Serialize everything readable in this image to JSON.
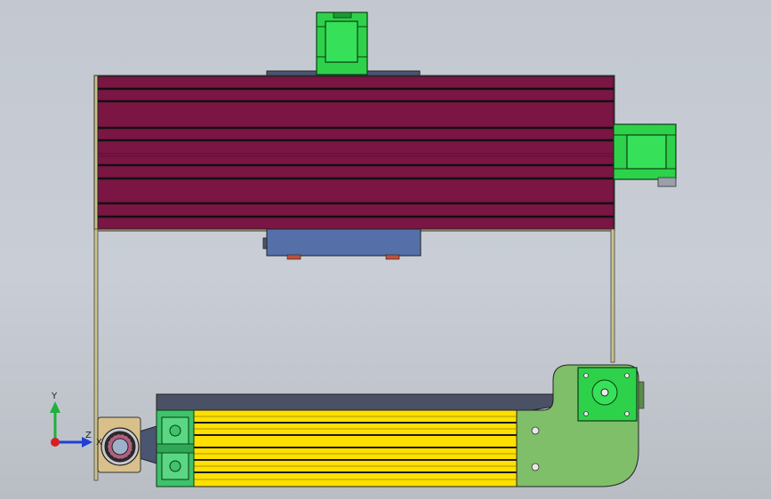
{
  "viewport": {
    "background_top": "#c3c8d0",
    "background_bottom": "#b9bdc4"
  },
  "colors": {
    "gantry_beam": "#7a1544",
    "beam_groove": "#111111",
    "frame_tan": "#c9c28a",
    "stepper_motor": "#2ed24a",
    "carriage_plate": "#5570a8",
    "linear_rail_yellow": "#ffe000",
    "rail_profile_green": "#3ec36a",
    "end_plate_green": "#7fbf6a",
    "dark_plate": "#4a5165",
    "bearing_block": "#d9c08a"
  },
  "triad": {
    "x_label": "X",
    "y_label": "Y",
    "z_label": "Z"
  }
}
